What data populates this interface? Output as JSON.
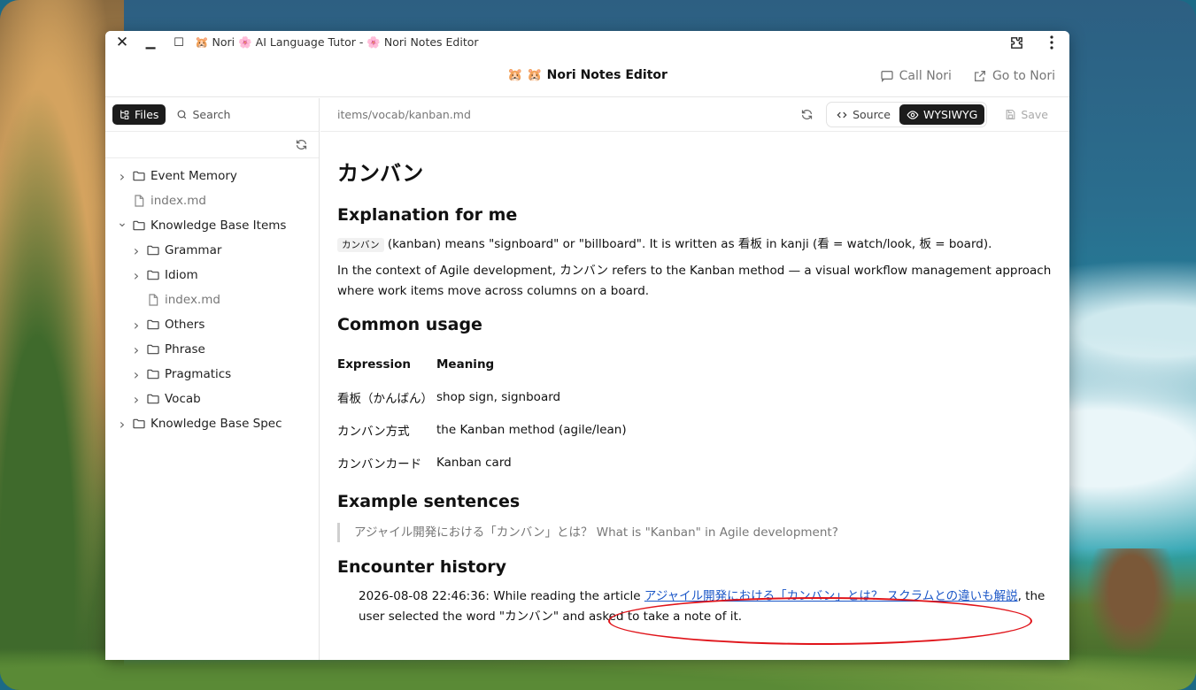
{
  "window": {
    "title": "🐹 Nori 🌸 AI Language Tutor - 🌸 Nori Notes Editor"
  },
  "header": {
    "title": "🐹 🐹 Nori Notes Editor",
    "call_label": "Call Nori",
    "goto_label": "Go to Nori"
  },
  "sidebar": {
    "tab_files": "Files",
    "tab_search": "Search",
    "tree": [
      {
        "label": "Event Memory",
        "type": "folder",
        "level": 0,
        "expanded": false
      },
      {
        "label": "index.md",
        "type": "file",
        "level": 0
      },
      {
        "label": "Knowledge Base Items",
        "type": "folder",
        "level": 0,
        "expanded": true
      },
      {
        "label": "Grammar",
        "type": "folder",
        "level": 1,
        "expanded": false
      },
      {
        "label": "Idiom",
        "type": "folder",
        "level": 1,
        "expanded": false
      },
      {
        "label": "index.md",
        "type": "file",
        "level": 1
      },
      {
        "label": "Others",
        "type": "folder",
        "level": 1,
        "expanded": false
      },
      {
        "label": "Phrase",
        "type": "folder",
        "level": 1,
        "expanded": false
      },
      {
        "label": "Pragmatics",
        "type": "folder",
        "level": 1,
        "expanded": false
      },
      {
        "label": "Vocab",
        "type": "folder",
        "level": 1,
        "expanded": false
      },
      {
        "label": "Knowledge Base Spec",
        "type": "folder",
        "level": 0,
        "expanded": false
      }
    ]
  },
  "editor": {
    "path": "items/vocab/kanban.md",
    "source_label": "Source",
    "wysiwyg_label": "WYSIWYG",
    "save_label": "Save"
  },
  "doc": {
    "title": "カンバン",
    "explanation_heading": "Explanation for me",
    "explanation_code": "カンバン",
    "explanation_line1": " (kanban) means \"signboard\" or \"billboard\". It is written as 看板 in kanji (看 = watch/look, 板 = board).",
    "explanation_line2": "In the context of Agile development, カンバン refers to the Kanban method — a visual workflow management approach where work items move across columns on a board.",
    "usage_heading": "Common usage",
    "table_headers": [
      "Expression",
      "Meaning"
    ],
    "table_rows": [
      [
        "看板（かんばん）",
        "shop sign, signboard"
      ],
      [
        "カンバン方式",
        "the Kanban method (agile/lean)"
      ],
      [
        "カンバンカード",
        "Kanban card"
      ]
    ],
    "examples_heading": "Example sentences",
    "example_quote": "アジャイル開発における「カンバン」とは？  What is \"Kanban\" in Agile development?",
    "encounter_heading": "Encounter history",
    "encounter_prefix": "2026-08-08 22:46:36: While reading the article ",
    "encounter_link": "アジャイル開発における「カンバン」とは？ スクラムとの違いも解説",
    "encounter_suffix": ", the user selected the word \"カンバン\" and asked to take a note of it."
  },
  "colors": {
    "accent_dark": "#1c1c1c",
    "link": "#1a56c7",
    "annotation": "#e0141a"
  }
}
